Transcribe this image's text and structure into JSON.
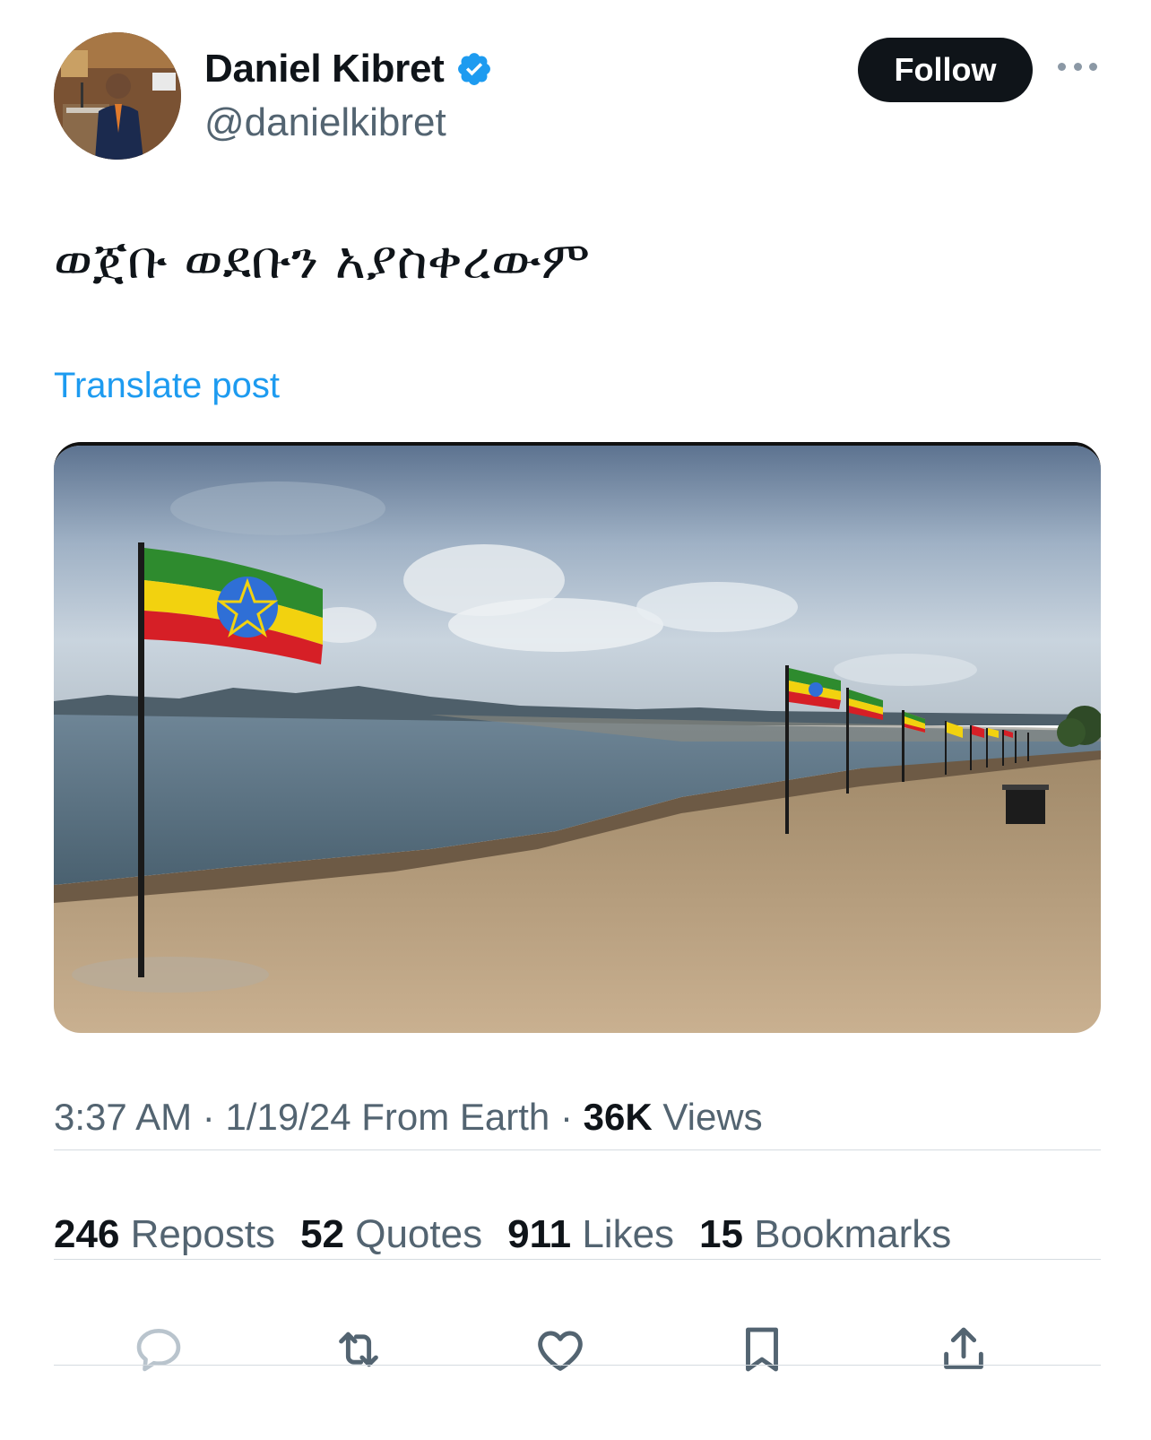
{
  "author": {
    "display_name": "Daniel Kibret",
    "handle": "@danielkibret",
    "verified_icon": "verified-badge-icon"
  },
  "follow_label": "Follow",
  "more_icon": "more-dots-icon",
  "post": {
    "text": "ወጀቡ ወደቡን አያስቀረውም",
    "translate_label": "Translate post"
  },
  "meta": {
    "time": "3:37 AM",
    "sep1": " · ",
    "date": "1/19/24",
    "source": " From Earth",
    "sep2": " · ",
    "views_count": "36K",
    "views_label": " Views"
  },
  "stats": [
    {
      "count": "246",
      "label": " Reposts"
    },
    {
      "count": "52",
      "label": " Quotes"
    },
    {
      "count": "911",
      "label": " Likes"
    },
    {
      "count": "15",
      "label": " Bookmarks"
    }
  ],
  "actions": [
    "reply-icon",
    "repost-icon",
    "like-icon",
    "bookmark-icon",
    "share-icon"
  ],
  "colors": {
    "accent": "#1d9bf0",
    "text": "#0f1419",
    "secondary": "#536471",
    "flag_green": "#2e8b2e",
    "flag_yellow": "#f2d20f",
    "flag_red": "#d61f26",
    "flag_blue": "#2f6fd6"
  }
}
